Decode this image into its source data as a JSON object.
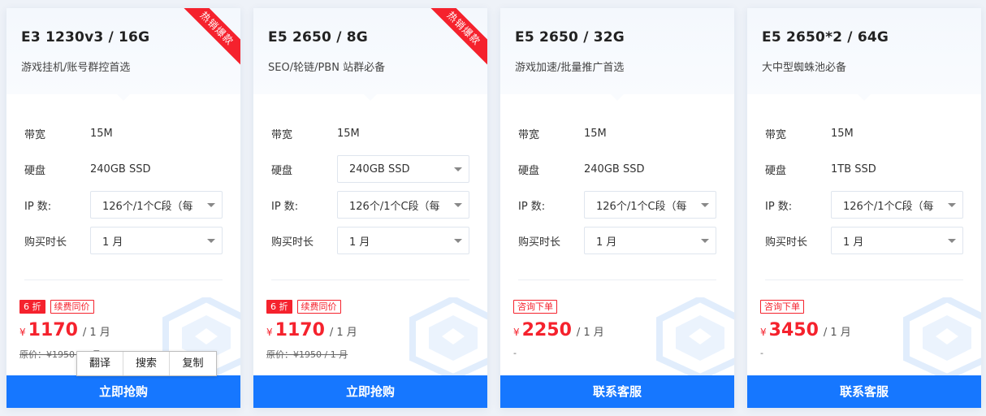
{
  "labels": {
    "bandwidth": "带宽",
    "disk": "硬盘",
    "ip": "IP 数:",
    "duration": "购买时长",
    "currency": "¥",
    "per_unit": "/ 1 月"
  },
  "plans": [
    {
      "title": "E3 1230v3 / 16G",
      "subtitle": "游戏挂机/账号群控首选",
      "ribbon": "热销爆款",
      "bandwidth": "15M",
      "disk": "240GB SSD",
      "ip": "126个/1个C段（每",
      "duration": "1 月",
      "discount": "6 折",
      "tag": "续费同价",
      "price": "1170",
      "original": "原价：¥1950 / 1 月",
      "button": "立即抢购"
    },
    {
      "title": "E5 2650 / 8G",
      "subtitle": "SEO/轮链/PBN 站群必备",
      "ribbon": "热销爆款",
      "bandwidth": "15M",
      "disk": "240GB SSD",
      "ip": "126个/1个C段（每",
      "duration": "1 月",
      "discount": "6 折",
      "tag": "续费同价",
      "price": "1170",
      "original": "原价：¥1950 / 1 月",
      "button": "立即抢购"
    },
    {
      "title": "E5 2650 / 32G",
      "subtitle": "游戏加速/批量推广首选",
      "bandwidth": "15M",
      "disk": "240GB SSD",
      "ip": "126个/1个C段（每",
      "duration": "1 月",
      "tag": "咨询下单",
      "price": "2250",
      "original": "-",
      "button": "联系客服"
    },
    {
      "title": "E5 2650*2 / 64G",
      "subtitle": "大中型蜘蛛池必备",
      "bandwidth": "15M",
      "disk": "1TB SSD",
      "ip": "126个/1个C段（每",
      "duration": "1 月",
      "tag": "咨询下单",
      "price": "3450",
      "original": "-",
      "button": "联系客服"
    }
  ],
  "context_menu": {
    "translate": "翻译",
    "search": "搜索",
    "copy": "复制"
  },
  "colors": {
    "accent": "#1677ff",
    "price_red": "#f5222d"
  }
}
